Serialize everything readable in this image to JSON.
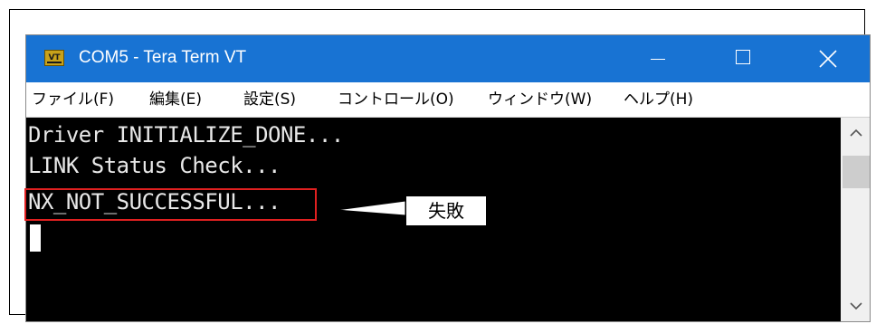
{
  "window": {
    "title": "COM5 - Tera Term VT",
    "icon": "tera-term-app-icon",
    "app_icon_text": "VT",
    "controls": [
      "minimize-icon",
      "maximize-icon",
      "close-icon"
    ]
  },
  "menu": {
    "items": [
      {
        "label": "ファイル(F)"
      },
      {
        "label": "編集(E)"
      },
      {
        "label": "設定(S)"
      },
      {
        "label": "コントロール(O)"
      },
      {
        "label": "ウィンドウ(W)"
      },
      {
        "label": "ヘルプ(H)"
      }
    ]
  },
  "terminal": {
    "lines": [
      "Driver INITIALIZE_DONE...",
      "LINK Status Check...",
      "NX_NOT_SUCCESSFUL..."
    ],
    "background": "#000000",
    "text_color": "#e8e8e8"
  },
  "annotation": {
    "label": "失敗",
    "highlight_color": "#e02020"
  },
  "colors": {
    "titlebar": "#1873d3",
    "menubar": "#ffffff",
    "scrollbar": "#f0f0f0"
  }
}
